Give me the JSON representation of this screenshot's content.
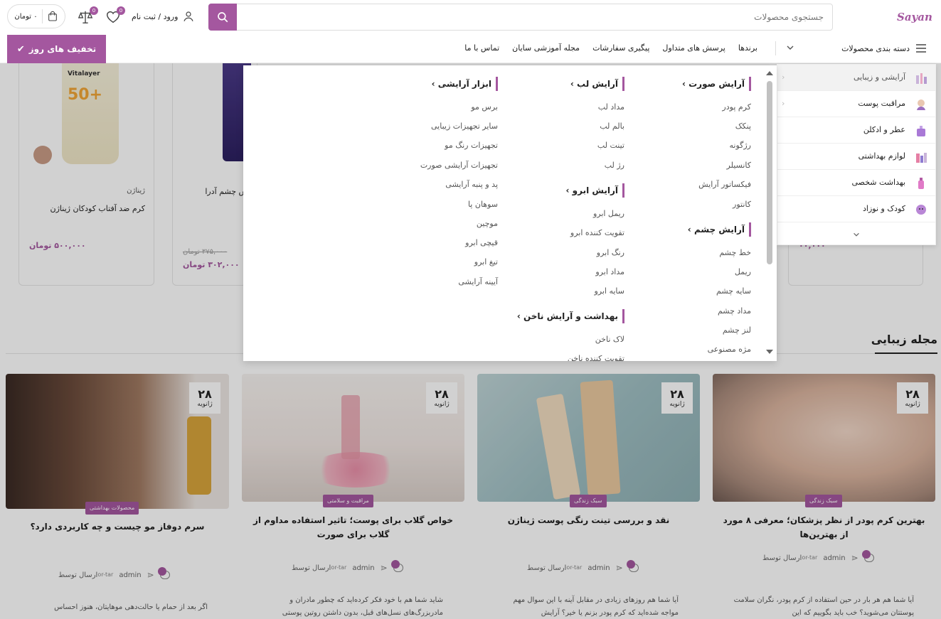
{
  "header": {
    "logo_text": "Sayan",
    "search_placeholder": "جستجوی محصولات",
    "login_label": "ورود / ثبت نام",
    "wishlist_count": "0",
    "compare_count": "0",
    "cart_label": "۰ تومان"
  },
  "nav": {
    "categories_label": "دسته بندی محصولات",
    "links": [
      "برندها",
      "پرسش های متداول",
      "پیگیری سفارشات",
      "مجله آموزشی سایان",
      "تماس با ما"
    ],
    "deal_label": "تخفیف های روز"
  },
  "categories": [
    {
      "label": "آرایشی و زیبایی",
      "has_arrow": true
    },
    {
      "label": "مراقبت پوست",
      "has_arrow": true
    },
    {
      "label": "عطر و ادکلن",
      "has_arrow": false
    },
    {
      "label": "لوازم بهداشتی",
      "has_arrow": false
    },
    {
      "label": "بهداشت شخصی",
      "has_arrow": false
    },
    {
      "label": "کودک و نوزاد",
      "has_arrow": false
    }
  ],
  "mega": {
    "face": {
      "title": "آرایش صورت",
      "items": [
        "کرم پودر",
        "پنکک",
        "رژگونه",
        "کانسیلر",
        "فیکساتور آرایش",
        "کانتور"
      ]
    },
    "eye": {
      "title": "آرایش چشم",
      "items": [
        "خط چشم",
        "ریمل",
        "سایه چشم",
        "مداد چشم",
        "لنز چشم",
        "مژه مصنوعی"
      ]
    },
    "lip": {
      "title": "آرایش لب",
      "items": [
        "مداد لب",
        "بالم لب",
        "تینت لب",
        "رژ لب"
      ]
    },
    "brow": {
      "title": "آرایش ابرو",
      "items": [
        "ریمل ابرو",
        "تقویت کننده ابرو",
        "رنگ ابرو",
        "مداد ابرو",
        "سایه ابرو"
      ]
    },
    "nail": {
      "title": "بهداشت و آرایش ناخن",
      "items": [
        "لاک ناخن",
        "تقویت کننده ناخن"
      ]
    },
    "tools": {
      "title": "ابزار آرایشی",
      "items": [
        "برس مو",
        "سایر تجهیزات زیبایی",
        "تجهیزات رنگ مو",
        "تجهیزات آرایشی صورت",
        "پد و پنبه آرایشی",
        "سوهان پا",
        "موچین",
        "قیچی ابرو",
        "تیغ ابرو",
        "آیینه آرایشی"
      ]
    }
  },
  "products": [
    {
      "brand": "ژیناژن",
      "name": "کرم ضد آفتاب کودکان ژیناژن",
      "price": "۵۰۰,۰۰۰ تومان",
      "old_price": ""
    },
    {
      "brand": "",
      "name": "ش چشم آدرا",
      "price": "۳۰۲,۰۰۰ تومان",
      "old_price": "۳۷۵,۰۰۰ تومان"
    }
  ],
  "partial_price": "۰۰,۰۰۰",
  "bottle_text": {
    "brand": "Vitalayer",
    "spf": "50+"
  },
  "blog": {
    "title": "مجله زیبایی",
    "posts": [
      {
        "day": "۲۸",
        "month": "ژانویه",
        "tag": "سبک زندگی",
        "title": "بهترین کرم پودر از نظر پزشکان؛ معرفی ۸ مورد از بهترین‌ها",
        "by": "ارسال توسط",
        "author": "admin",
        "excerpt": "آیا شما هم هر بار در حین استفاده از کرم پودر، نگران سلامت پوستتان می‌شوید؟ خب باید بگوییم که این"
      },
      {
        "day": "۲۸",
        "month": "ژانویه",
        "tag": "سبک زندگی",
        "title": "نقد و بررسی تینت رنگی پوست ژیناژن",
        "by": "ارسال توسط",
        "author": "admin",
        "excerpt": "آیا شما هم روزهای زیادی در مقابل آینه با این سوال مهم مواجه شده‌اید که کرم پودر بزنم یا خیر؟ آرایش"
      },
      {
        "day": "۲۸",
        "month": "ژانویه",
        "tag": "مراقبت و سلامتی",
        "title": "خواص گلاب برای پوست؛ تاثیر استفاده مداوم از گلاب برای صورت",
        "by": "ارسال توسط",
        "author": "admin",
        "excerpt": "شاید شما هم با خود فکر کرده‌اید که چطور مادران و مادربزرگ‌های نسل‌های قبل، بدون داشتن روتین پوستی"
      },
      {
        "day": "۲۸",
        "month": "ژانویه",
        "tag": "محصولات بهداشتی",
        "title": "سرم دوفاز مو چیست و چه کاربردی دارد؟",
        "by": "ارسال توسط",
        "author": "admin",
        "excerpt": "اگر بعد از حمام یا حالت‌دهی موهایتان، هنوز احساس"
      }
    ],
    "avatar_alt": "or-tar"
  },
  "colors": {
    "accent": "#a4579f"
  }
}
